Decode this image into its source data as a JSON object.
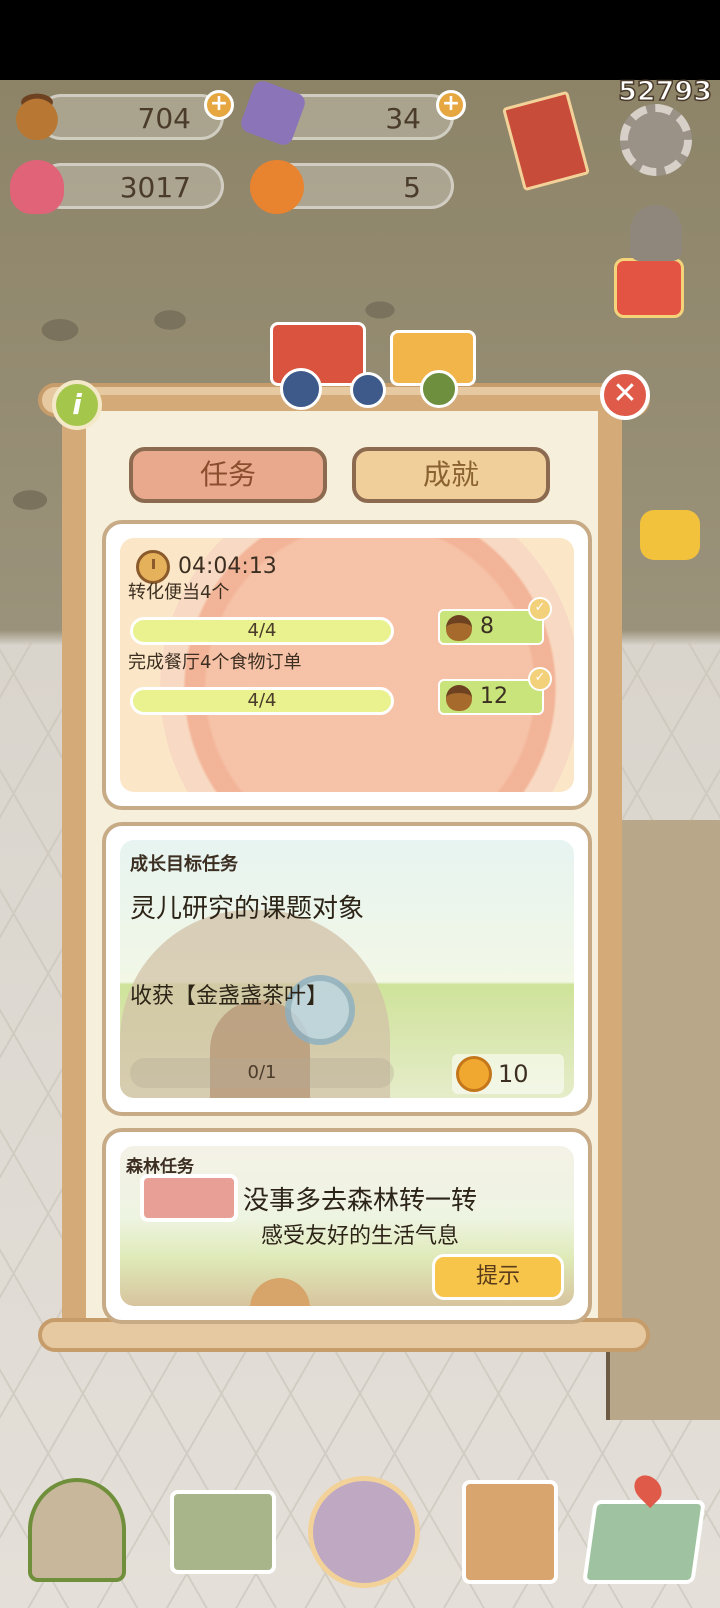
{
  "resources": {
    "acorn": {
      "icon": "acorn-icon",
      "value": "704"
    },
    "gem": {
      "icon": "crystal-icon",
      "value": "34"
    },
    "heart": {
      "icon": "heart-icon",
      "value": "3017"
    },
    "fruit": {
      "icon": "orange-icon",
      "value": "5"
    }
  },
  "user_id": "52793",
  "tabs": {
    "task": "任务",
    "achievement": "成就"
  },
  "daily_card": {
    "timer": "04:04:13",
    "tasks": [
      {
        "name": "转化便当4个",
        "progress": "4/4",
        "reward": "8",
        "reward_icon": "acorn-icon"
      },
      {
        "name": "完成餐厅4个食物订单",
        "progress": "4/4",
        "reward": "12",
        "reward_icon": "acorn-icon"
      }
    ]
  },
  "growth_card": {
    "title": "成长目标任务",
    "main": "灵儿研究的课题对象",
    "sub": "收获【金盏盏茶叶】",
    "progress": "0/1",
    "reward": "10",
    "reward_icon": "bell-icon"
  },
  "forest_card": {
    "title": "森林任务",
    "main": "没事多去森林转一转",
    "sub": "感受友好的生活气息",
    "hint_button": "提示"
  },
  "colors": {
    "panel": "#d5aa79",
    "tab_active": "#e8a98d",
    "tab_inactive": "#f0cf9b",
    "progress": "#e9f28e",
    "reward_bg": "#c8e47a",
    "hint": "#f7c54a",
    "close": "#e05a49"
  },
  "bottom_nav": [
    "house-icon",
    "mail-icon",
    "character-icon",
    "clipboard-icon",
    "map-icon"
  ]
}
